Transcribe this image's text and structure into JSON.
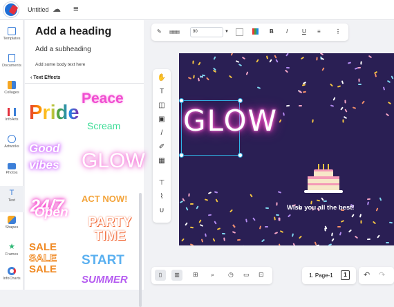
{
  "header": {
    "doc_title": "Untitled"
  },
  "rail": [
    {
      "label": "Templates",
      "icon": "templates-icon"
    },
    {
      "label": "Documents",
      "icon": "document-icon"
    },
    {
      "label": "Collages",
      "icon": "collage-icon"
    },
    {
      "label": "InfoArts",
      "icon": "infoart-icon"
    },
    {
      "label": "Artworks",
      "icon": "artwork-icon"
    },
    {
      "label": "Photos",
      "icon": "photo-icon"
    },
    {
      "label": "Text",
      "icon": "text-icon"
    },
    {
      "label": "Shapes",
      "icon": "shapes-icon"
    },
    {
      "label": "Frames",
      "icon": "frames-icon"
    },
    {
      "label": "InfoCharts",
      "icon": "infochart-icon"
    }
  ],
  "panel": {
    "heading": "Add a heading",
    "subheading": "Add a subheading",
    "body": "Add some body text here",
    "section": "Text Effects",
    "effects": [
      "Peace",
      "Pride",
      "Scream",
      "Good vibes",
      "GLOW",
      "24/7",
      "ACT NOW!",
      "Open",
      "PARTY TIME",
      "SALE",
      "SALE",
      "SALE",
      "START",
      "SUMMER"
    ]
  },
  "toolbar": {
    "font_size": "90"
  },
  "canvas": {
    "text": "GLOW",
    "message": "Wish you all the best!",
    "bg_color": "#2a1f54"
  },
  "pager": {
    "page_label": "1. Page-1",
    "page_count": "1"
  }
}
